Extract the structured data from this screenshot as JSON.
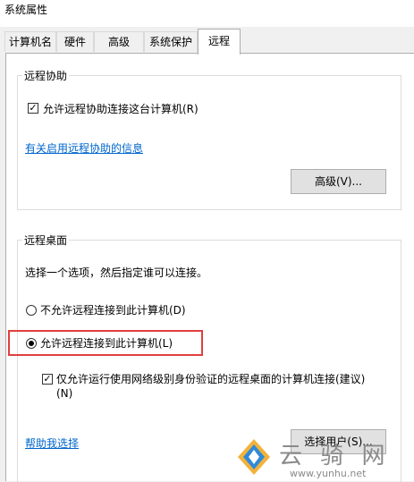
{
  "window": {
    "title": "系统属性"
  },
  "tabs": [
    {
      "label": "计算机名",
      "active": false
    },
    {
      "label": "硬件",
      "active": false
    },
    {
      "label": "高级",
      "active": false
    },
    {
      "label": "系统保护",
      "active": false
    },
    {
      "label": "远程",
      "active": true
    }
  ],
  "remote_assistance": {
    "group_title": "远程协助",
    "allow_checkbox_label": "允许远程协助连接这台计算机(R)",
    "allow_checked": true,
    "info_link": "有关启用远程协助的信息",
    "advanced_button": "高级(V)..."
  },
  "remote_desktop": {
    "group_title": "远程桌面",
    "instruction": "选择一个选项，然后指定谁可以连接。",
    "option_disallow": "不允许远程连接到此计算机(D)",
    "option_allow": "允许远程连接到此计算机(L)",
    "selected_option": "allow",
    "nla_checkbox_line1": "仅允许运行使用网络级别身份验证的远程桌面的计算机连接(建议)",
    "nla_checkbox_line2": "(N)",
    "nla_checked": true,
    "help_link": "帮助我选择",
    "select_users_button": "选择用户(S)..."
  },
  "watermark": {
    "text_cn": "云 骑 网",
    "url": "www.yunhu.net"
  }
}
